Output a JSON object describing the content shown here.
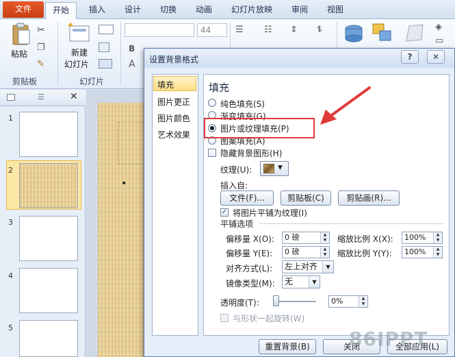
{
  "ribbon": {
    "tabs": [
      "文件",
      "开始",
      "插入",
      "设计",
      "切换",
      "动画",
      "幻灯片放映",
      "审阅",
      "视图"
    ],
    "font_size": "44",
    "groups": {
      "clipboard": "剪贴板",
      "slides": "幻灯片"
    },
    "paste_label": "粘贴",
    "new_slide_label_line1": "新建",
    "new_slide_label_line2": "幻灯片"
  },
  "left_panel": {
    "slide_numbers": [
      "1",
      "2",
      "3",
      "4",
      "5"
    ],
    "close_glyph": "✕"
  },
  "dialog": {
    "title": "设置背景格式",
    "help_glyph": "?",
    "close_glyph": "✕",
    "nav": [
      "填充",
      "图片更正",
      "图片颜色",
      "艺术效果"
    ],
    "heading": "填充",
    "options": {
      "solid": "纯色填充(S)",
      "gradient": "渐变填充(G)",
      "picture": "图片或纹理填充(P)",
      "pattern": "图案填充(A)"
    },
    "hide_bg": "隐藏背景图形(H)",
    "texture_label": "纹理(U):",
    "insert_from": "插入自:",
    "btn_file": "文件(F)...",
    "btn_clipboard": "剪贴板(C)",
    "btn_clipart": "剪贴画(R)...",
    "tile_label": "将图片平铺为纹理(I)",
    "tile_options": "平铺选项",
    "offset_x_label": "偏移量 X(O):",
    "offset_x_value": "0 磅",
    "scale_x_label": "缩放比例 X(X):",
    "scale_x_value": "100%",
    "offset_y_label": "偏移量 Y(E):",
    "offset_y_value": "0 磅",
    "scale_y_label": "缩放比例 Y(Y):",
    "scale_y_value": "100%",
    "align_label": "对齐方式(L):",
    "align_value": "左上对齐",
    "mirror_label": "镜像类型(M):",
    "mirror_value": "无",
    "transparency_label": "透明度(T):",
    "transparency_value": "0%",
    "transparency_level": 0,
    "rotate_label": "与形状一起旋转(W)",
    "btn_reset": "重置背景(B)",
    "btn_close": "关闭",
    "btn_apply_all": "全部应用(L)"
  },
  "watermark": "86IPPT",
  "colors": {
    "file_tab": "#d9501f",
    "highlight": "#e03a3a"
  }
}
